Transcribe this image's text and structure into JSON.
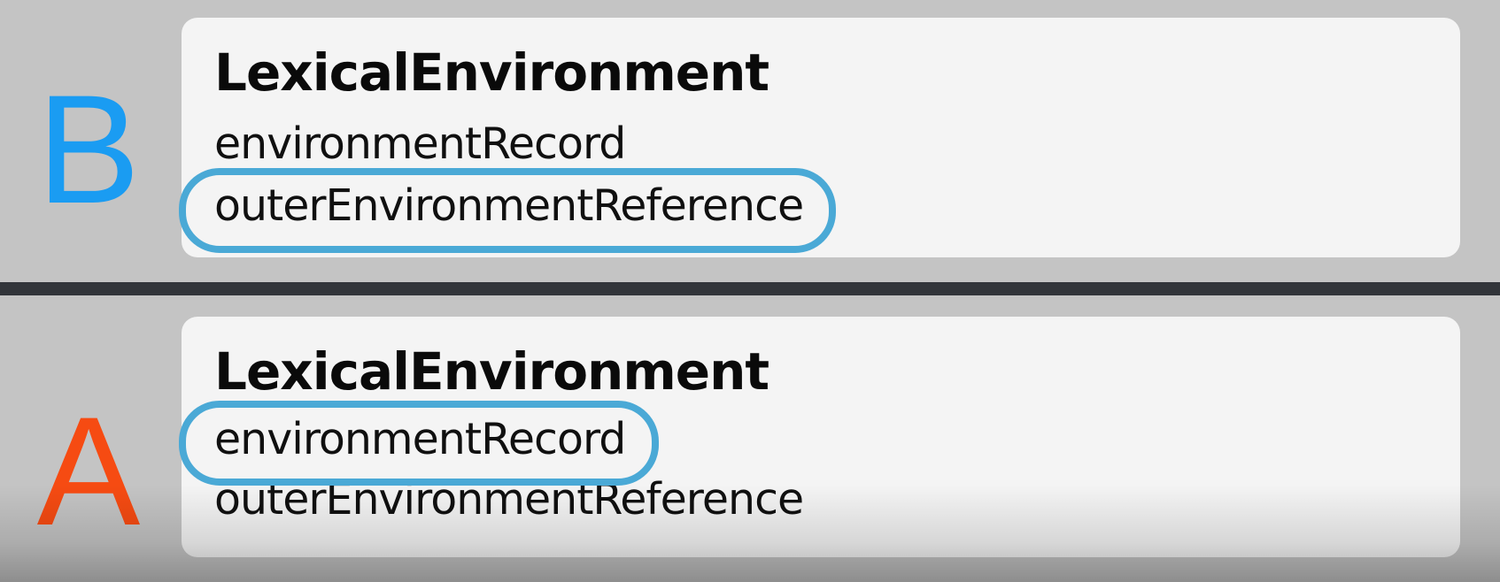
{
  "panels": {
    "top": {
      "letter": "B",
      "title": "LexicalEnvironment",
      "fields": [
        "environmentRecord",
        "outerEnvironmentReference"
      ],
      "highlighted_field": "outerEnvironmentReference"
    },
    "bottom": {
      "letter": "A",
      "title": "LexicalEnvironment",
      "fields": [
        "environmentRecord",
        "outerEnvironmentReference"
      ],
      "highlighted_field": "environmentRecord"
    }
  },
  "colors": {
    "letter_b": "#1a9cf2",
    "letter_a": "#f64b12",
    "highlight_ring": "#4aa9d6",
    "divider": "#32353a",
    "card": "#f4f4f4",
    "background": "#c4c4c4"
  }
}
